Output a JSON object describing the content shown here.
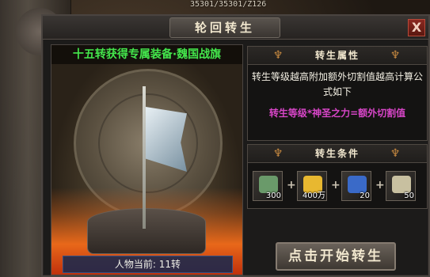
{
  "hud": {
    "stats": "35301/35301/Z126"
  },
  "window": {
    "title": "轮回转生",
    "close_label": "X"
  },
  "equipment": {
    "title": "十五转获得专属装备·魏国战旗",
    "character_level": "人物当前: 11转"
  },
  "attributes": {
    "header": "转生属性",
    "description": "转生等级越高附加额外切割值越高计算公式如下",
    "formula": "转生等级*神圣之力=额外切割值"
  },
  "conditions": {
    "header": "转生条件",
    "items": [
      {
        "icon": "jade-ore-icon",
        "quantity": "300",
        "color": "#6a9a6a"
      },
      {
        "icon": "gold-ingot-icon",
        "quantity": "400万",
        "color": "#e8b830"
      },
      {
        "icon": "blue-book-icon",
        "quantity": "20",
        "color": "#3a6ac8"
      },
      {
        "icon": "gem-pile-icon",
        "quantity": "50",
        "color": "#c8c0a0"
      }
    ]
  },
  "start_button": {
    "label": "点击开始转生"
  }
}
